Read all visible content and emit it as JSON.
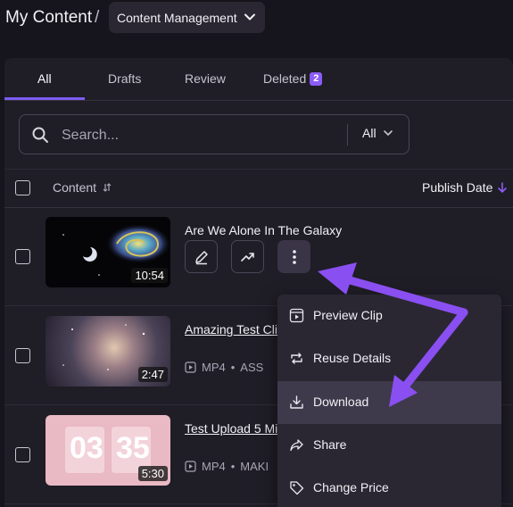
{
  "header": {
    "title": "My Content",
    "separator": "/",
    "dropdown_label": "Content Management"
  },
  "tabs": [
    {
      "label": "All",
      "active": true
    },
    {
      "label": "Drafts"
    },
    {
      "label": "Review"
    },
    {
      "label": "Deleted",
      "badge": "2"
    }
  ],
  "search": {
    "placeholder": "Search...",
    "filter_value": "All"
  },
  "table": {
    "col_content": "Content",
    "col_publish_date": "Publish Date"
  },
  "rows": [
    {
      "title": "Are We Alone In The Galaxy",
      "duration": "10:54"
    },
    {
      "title": "Amazing Test Cli",
      "duration": "2:47",
      "format": "MP4",
      "meta2": "ASS"
    },
    {
      "title": "Test Upload 5 Mi",
      "duration": "5:30",
      "format": "MP4",
      "meta2": "MAKI",
      "thumb_text_left": "03",
      "thumb_text_right": "35"
    }
  ],
  "menu": {
    "items": [
      {
        "label": "Preview Clip",
        "icon": "preview-clip-icon"
      },
      {
        "label": "Reuse Details",
        "icon": "reuse-icon"
      },
      {
        "label": "Download",
        "icon": "download-icon",
        "highlighted": true
      },
      {
        "label": "Share",
        "icon": "share-icon"
      },
      {
        "label": "Change Price",
        "icon": "tag-icon"
      }
    ]
  },
  "colors": {
    "accent": "#8b5cf6",
    "annotation_arrow": "#8a4ff0"
  }
}
